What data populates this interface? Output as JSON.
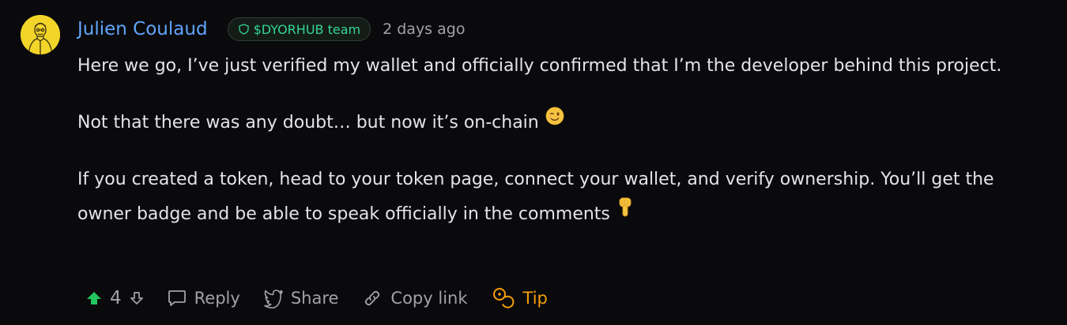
{
  "comment": {
    "author": "Julien Coulaud",
    "badge": "$DYORHUB team",
    "timestamp": "2 days ago",
    "paragraphs": [
      "Here we go, I’ve just verified my wallet and officially confirmed that I’m the developer behind this project.",
      "Not that there was any doubt… but now it’s on-chain",
      "If you created a token, head to your token page, connect your wallet, and verify ownership. You’ll get the owner badge and be able to speak officially in the comments"
    ],
    "paragraph_emojis": [
      "",
      "winking-face-emoji",
      "backhand-index-pointing-down-emoji"
    ]
  },
  "actions": {
    "vote_count": "4",
    "reply_label": "Reply",
    "share_label": "Share",
    "copy_link_label": "Copy link",
    "tip_label": "Tip"
  },
  "colors": {
    "background": "#0a0a0c",
    "author": "#60a5fa",
    "badge_text": "#34d399",
    "upvote_active": "#22c55e",
    "tip": "#f59e0b",
    "muted": "#a1a1aa",
    "avatar_bg": "#f3d429"
  },
  "icons": [
    "avatar",
    "shield-icon",
    "upvote-arrow-icon",
    "downvote-arrow-icon",
    "reply-bubble-icon",
    "share-twitter-icon",
    "link-icon",
    "coins-icon"
  ]
}
